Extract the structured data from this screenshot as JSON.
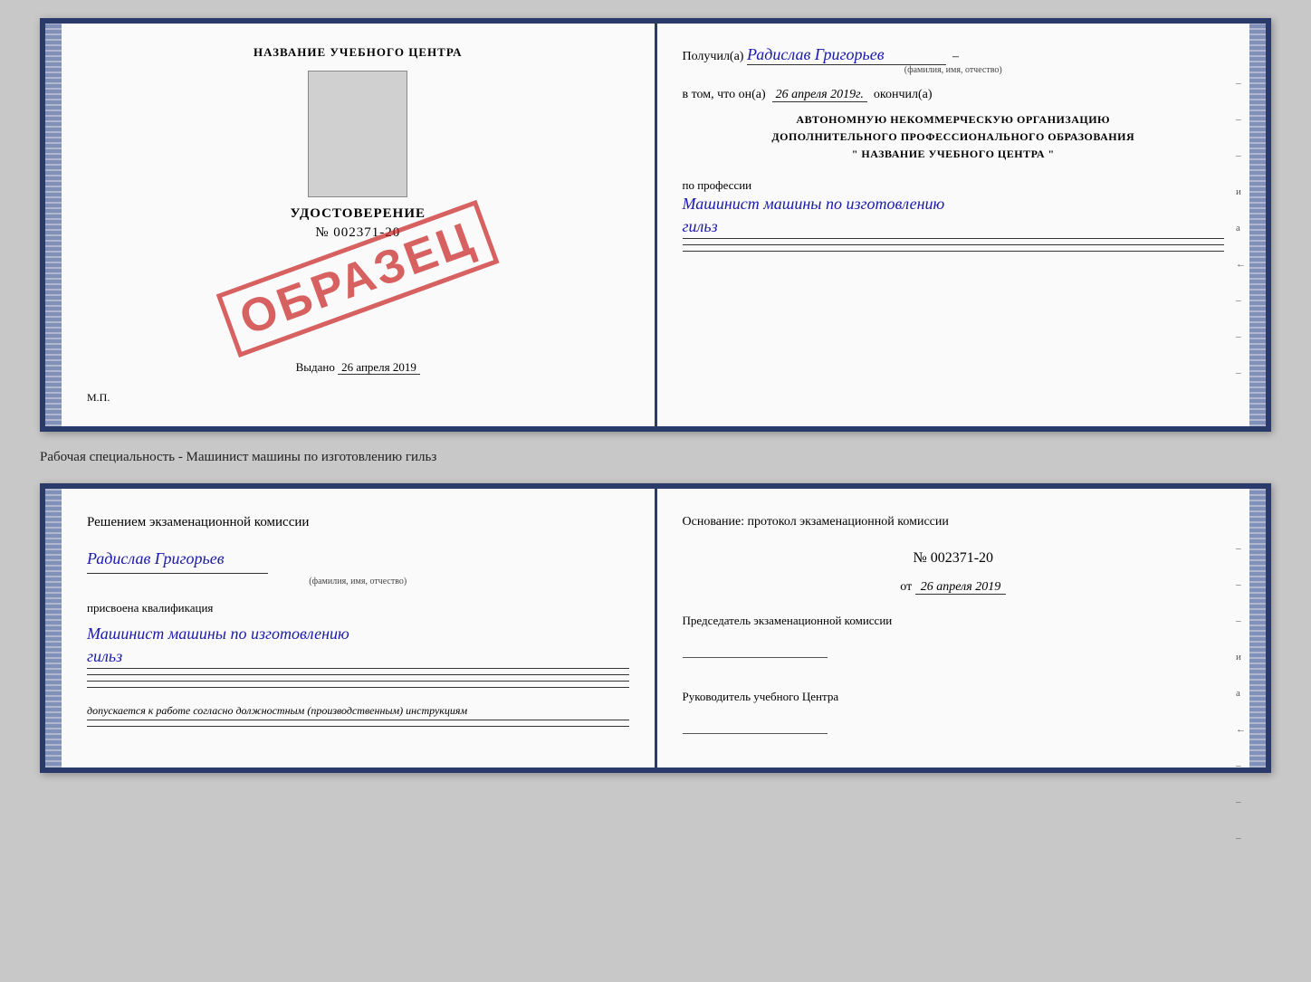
{
  "top_cert": {
    "left": {
      "title": "НАЗВАНИЕ УЧЕБНОГО ЦЕНТРА",
      "stamp_label": "ОБРАЗЕЦ",
      "udostoverenie_label": "УДОСТОВЕРЕНИЕ",
      "number": "№ 002371-20",
      "issued_label": "Выдано",
      "issued_date": "26 апреля 2019",
      "mp_label": "М.П."
    },
    "right": {
      "received_prefix": "Получил(а)",
      "recipient_name": "Радислав Григорьев",
      "recipient_sublabel": "(фамилия, имя, отчество)",
      "date_prefix": "в том, что он(а)",
      "date_value": "26 апреля 2019г.",
      "date_suffix": "окончил(а)",
      "org_line1": "АВТОНОМНУЮ НЕКОММЕРЧЕСКУЮ ОРГАНИЗАЦИЮ",
      "org_line2": "ДОПОЛНИТЕЛЬНОГО ПРОФЕССИОНАЛЬНОГО ОБРАЗОВАНИЯ",
      "org_line3": "\"  НАЗВАНИЕ УЧЕБНОГО ЦЕНТРА  \"",
      "profession_prefix": "по профессии",
      "profession_name": "Машинист машины по изготовлению",
      "profession_name2": "гильз",
      "side_marks": [
        "–",
        "–",
        "–",
        "и",
        "а",
        "←",
        "–",
        "–",
        "–"
      ]
    }
  },
  "caption": "Рабочая специальность - Машинист машины по изготовлению гильз",
  "bottom_cert": {
    "left": {
      "decision_text": "Решением  экзаменационной  комиссии",
      "name": "Радислав Григорьев",
      "name_sublabel": "(фамилия, имя, отчество)",
      "qualification_prefix": "присвоена квалификация",
      "qualification_name": "Машинист машины по изготовлению",
      "qualification_name2": "гильз",
      "допускается_text": "допускается к  работе согласно должностным (производственным) инструкциям"
    },
    "right": {
      "basis_text": "Основание: протокол экзаменационной  комиссии",
      "protocol_number": "№  002371-20",
      "protocol_date_prefix": "от",
      "protocol_date": "26 апреля 2019",
      "chairman_title": "Председатель экзаменационной комиссии",
      "director_title": "Руководитель учебного Центра",
      "side_marks": [
        "–",
        "–",
        "–",
        "и",
        "а",
        "←",
        "–",
        "–",
        "–"
      ]
    }
  }
}
